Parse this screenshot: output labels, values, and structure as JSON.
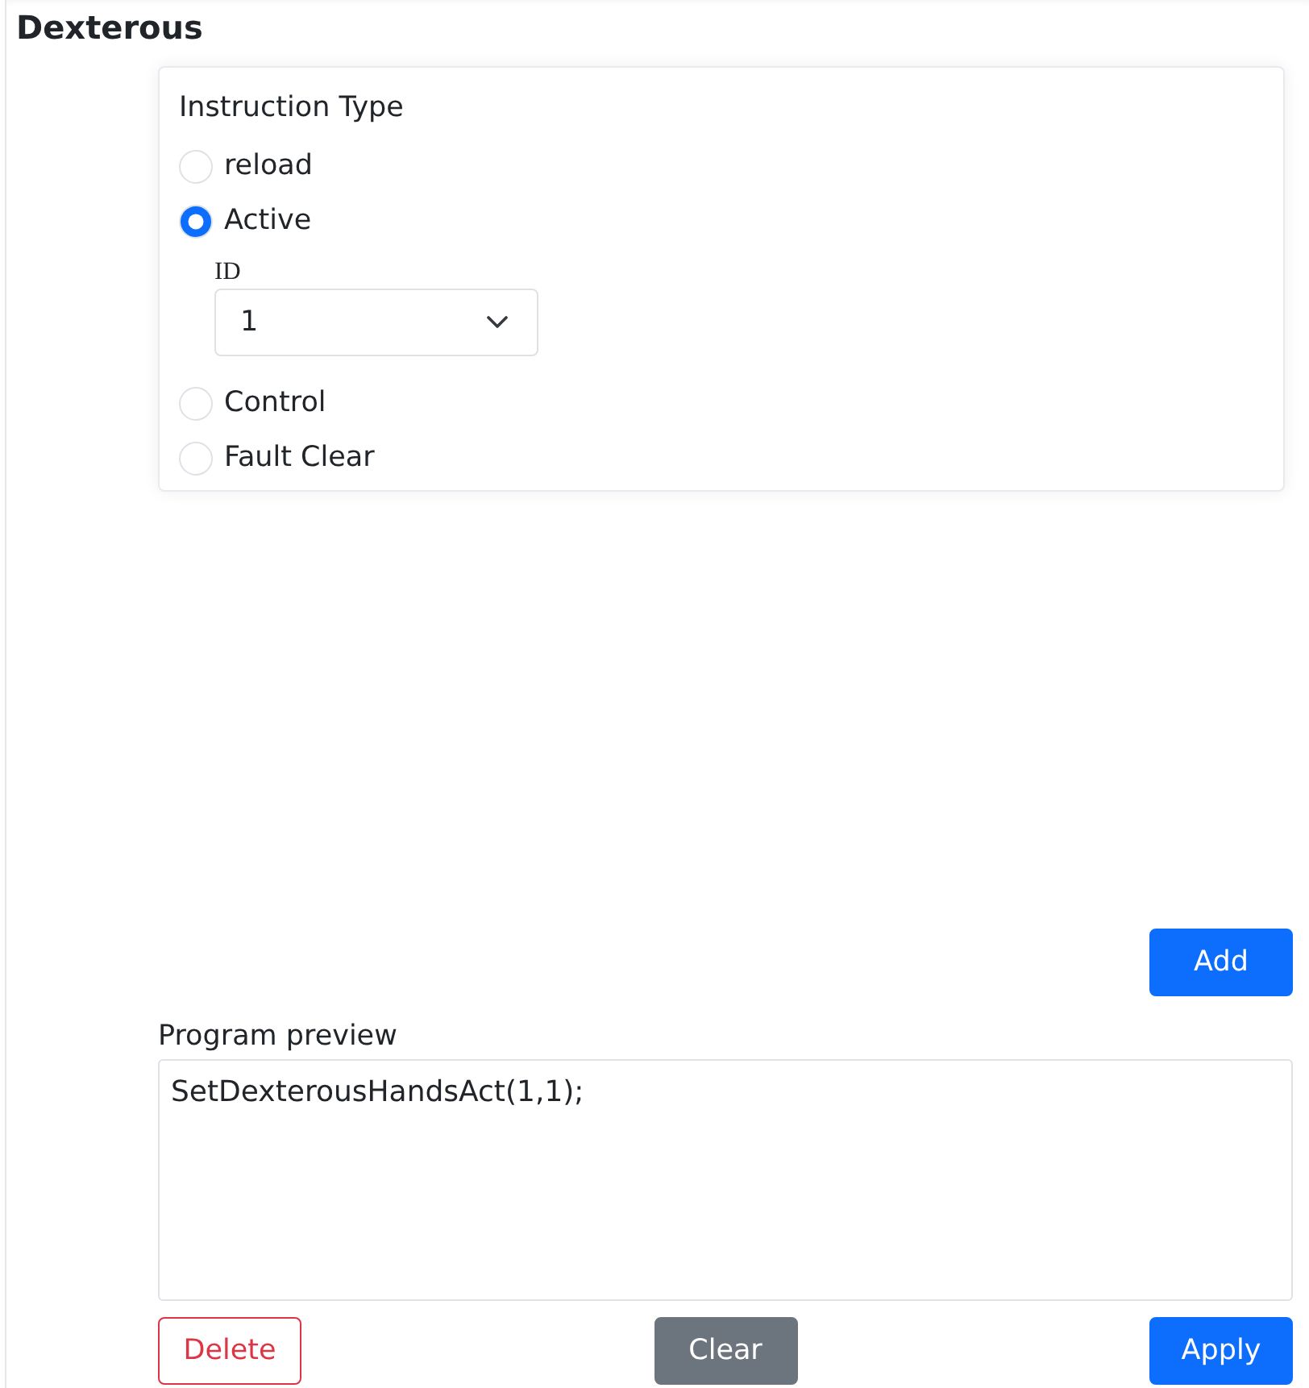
{
  "title": "Dexterous",
  "instruction_type": {
    "label": "Instruction Type",
    "options": [
      {
        "label": "reload",
        "selected": false
      },
      {
        "label": "Active",
        "selected": true,
        "id_field": {
          "label": "ID",
          "value": "1"
        }
      },
      {
        "label": "Control",
        "selected": false
      },
      {
        "label": "Fault Clear",
        "selected": false
      }
    ]
  },
  "add_button": {
    "label": "Add",
    "kind": "primary"
  },
  "program_preview": {
    "label": "Program preview",
    "value": "SetDexterousHandsAct(1,1);"
  },
  "actions": [
    {
      "label": "Delete",
      "kind": "outline-danger"
    },
    {
      "label": "Clear",
      "kind": "secondary"
    },
    {
      "label": "Apply",
      "kind": "primary"
    }
  ]
}
